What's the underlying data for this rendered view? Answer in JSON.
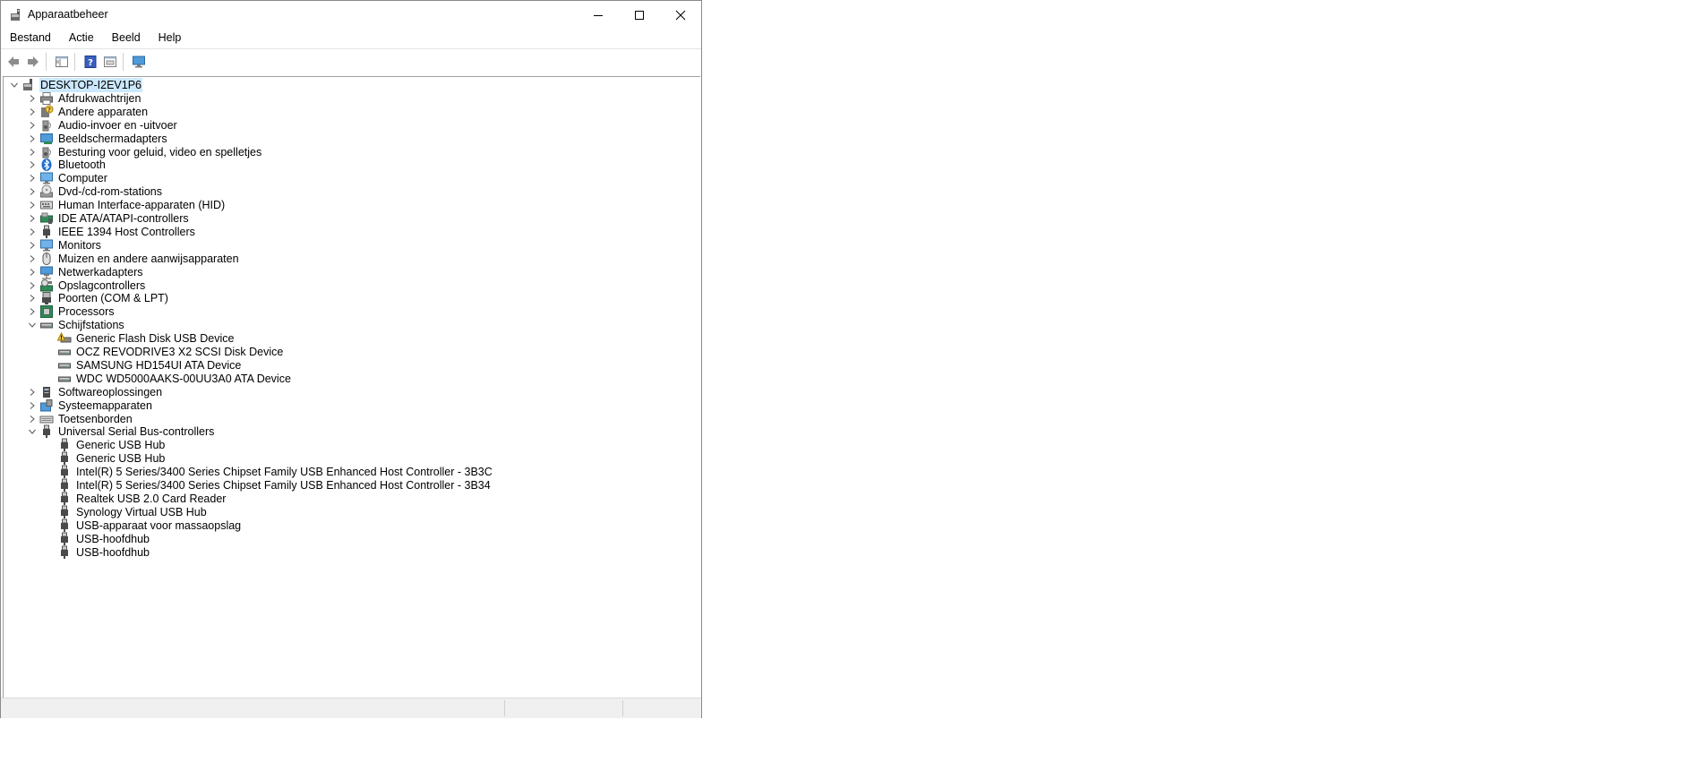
{
  "window": {
    "title": "Apparaatbeheer"
  },
  "menu": [
    {
      "label": "Bestand"
    },
    {
      "label": "Actie"
    },
    {
      "label": "Beeld"
    },
    {
      "label": "Help"
    }
  ],
  "tree": {
    "root": {
      "label": "DESKTOP-I2EV1P6",
      "expanded": true,
      "icon": "computer-icon"
    },
    "items": [
      {
        "label": "Afdrukwachtrijen",
        "icon": "printer-icon",
        "expanded": false,
        "depth": 1
      },
      {
        "label": "Andere apparaten",
        "icon": "unknown-device-icon",
        "expanded": false,
        "depth": 1
      },
      {
        "label": "Audio-invoer en -uitvoer",
        "icon": "speaker-icon",
        "expanded": false,
        "depth": 1
      },
      {
        "label": "Beeldschermadapters",
        "icon": "display-adapter-icon",
        "expanded": false,
        "depth": 1
      },
      {
        "label": "Besturing voor geluid, video en spelletjes",
        "icon": "speaker-icon",
        "expanded": false,
        "depth": 1
      },
      {
        "label": "Bluetooth",
        "icon": "bluetooth-icon",
        "expanded": false,
        "depth": 1
      },
      {
        "label": "Computer",
        "icon": "monitor-icon",
        "expanded": false,
        "depth": 1
      },
      {
        "label": "Dvd-/cd-rom-stations",
        "icon": "optical-drive-icon",
        "expanded": false,
        "depth": 1
      },
      {
        "label": "Human Interface-apparaten (HID)",
        "icon": "hid-icon",
        "expanded": false,
        "depth": 1
      },
      {
        "label": "IDE ATA/ATAPI-controllers",
        "icon": "ide-controller-icon",
        "expanded": false,
        "depth": 1
      },
      {
        "label": "IEEE 1394 Host Controllers",
        "icon": "usb-plug-icon",
        "expanded": false,
        "depth": 1
      },
      {
        "label": "Monitors",
        "icon": "monitor-icon",
        "expanded": false,
        "depth": 1
      },
      {
        "label": "Muizen en andere aanwijsapparaten",
        "icon": "mouse-icon",
        "expanded": false,
        "depth": 1
      },
      {
        "label": "Netwerkadapters",
        "icon": "network-adapter-icon",
        "expanded": false,
        "depth": 1
      },
      {
        "label": "Opslagcontrollers",
        "icon": "storage-controller-icon",
        "expanded": false,
        "depth": 1
      },
      {
        "label": "Poorten (COM & LPT)",
        "icon": "port-icon",
        "expanded": false,
        "depth": 1
      },
      {
        "label": "Processors",
        "icon": "processor-icon",
        "expanded": false,
        "depth": 1
      },
      {
        "label": "Schijfstations",
        "icon": "disk-drive-icon",
        "expanded": true,
        "depth": 1
      },
      {
        "label": "Generic Flash Disk USB Device",
        "icon": "disk-drive-warning-icon",
        "depth": 2
      },
      {
        "label": "OCZ REVODRIVE3 X2 SCSI Disk Device",
        "icon": "disk-drive-icon",
        "depth": 2
      },
      {
        "label": "SAMSUNG HD154UI ATA Device",
        "icon": "disk-drive-icon",
        "depth": 2
      },
      {
        "label": "WDC WD5000AAKS-00UU3A0 ATA Device",
        "icon": "disk-drive-icon",
        "depth": 2
      },
      {
        "label": "Softwareoplossingen",
        "icon": "software-component-icon",
        "expanded": false,
        "depth": 1
      },
      {
        "label": "Systeemapparaten",
        "icon": "system-device-icon",
        "expanded": false,
        "depth": 1
      },
      {
        "label": "Toetsenborden",
        "icon": "keyboard-icon",
        "expanded": false,
        "depth": 1
      },
      {
        "label": "Universal Serial Bus-controllers",
        "icon": "usb-plug-icon",
        "expanded": true,
        "depth": 1
      },
      {
        "label": "Generic USB Hub",
        "icon": "usb-plug-icon",
        "depth": 2
      },
      {
        "label": "Generic USB Hub",
        "icon": "usb-plug-icon",
        "depth": 2
      },
      {
        "label": "Intel(R) 5 Series/3400 Series Chipset Family USB Enhanced Host Controller - 3B3C",
        "icon": "usb-plug-icon",
        "depth": 2
      },
      {
        "label": "Intel(R) 5 Series/3400 Series Chipset Family USB Enhanced Host Controller - 3B34",
        "icon": "usb-plug-icon",
        "depth": 2
      },
      {
        "label": "Realtek USB 2.0 Card Reader",
        "icon": "usb-plug-icon",
        "depth": 2
      },
      {
        "label": "Synology Virtual USB Hub",
        "icon": "usb-plug-icon",
        "depth": 2
      },
      {
        "label": "USB-apparaat voor massaopslag",
        "icon": "usb-plug-icon",
        "depth": 2
      },
      {
        "label": "USB-hoofdhub",
        "icon": "usb-plug-icon",
        "depth": 2
      },
      {
        "label": "USB-hoofdhub",
        "icon": "usb-plug-icon",
        "depth": 2
      }
    ]
  },
  "colors": {
    "selection": "#cce8ff",
    "border": "#a0a0a0",
    "statusbar": "#f0f0f0"
  }
}
